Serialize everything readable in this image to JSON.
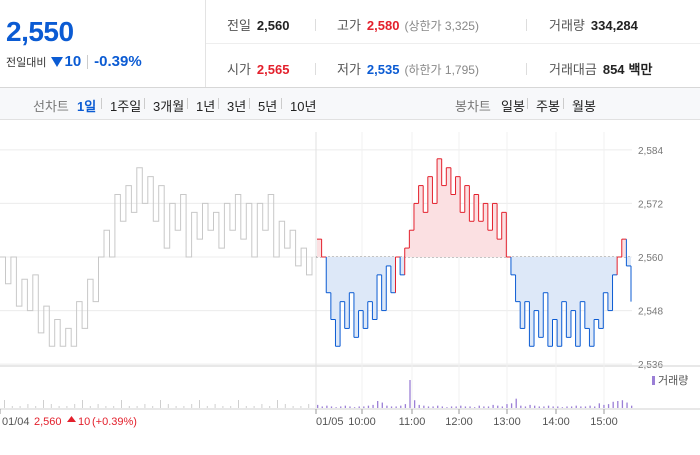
{
  "summary": {
    "price": "2,550",
    "change_label": "전일대비",
    "change_value": "10",
    "change_pct": "-0.39%",
    "prev_close_label": "전일",
    "prev_close": "2,560",
    "high_label": "고가",
    "high": "2,580",
    "upper_limit": "(상한가 3,325)",
    "volume_label": "거래량",
    "volume": "334,284",
    "open_label": "시가",
    "open": "2,565",
    "low_label": "저가",
    "low": "2,535",
    "lower_limit": "(하한가 1,795)",
    "amount_label": "거래대금",
    "amount": "854",
    "amount_unit": "백만"
  },
  "period_bar": {
    "label": "선차트",
    "periods": [
      "1일",
      "1주일",
      "3개월",
      "1년",
      "3년",
      "5년",
      "10년"
    ],
    "active": "1일",
    "candle_label": "봉차트",
    "candles": [
      "일봉",
      "주봉",
      "월봉"
    ]
  },
  "colors": {
    "up": "#e3202c",
    "down": "#0b5bd3",
    "prev_day_line": "#c8c8c8",
    "volume": "#9b7fd6"
  },
  "chart_data": {
    "type": "line",
    "ylim": [
      2532,
      2588
    ],
    "y_ticks": [
      "2,584",
      "2,572",
      "2,560",
      "2,548",
      "2,536"
    ],
    "y_tick_values": [
      2584,
      2572,
      2560,
      2548,
      2536
    ],
    "baseline": 2560,
    "x_labels": [
      "01/04",
      "01/05",
      "10:00",
      "11:00",
      "12:00",
      "13:00",
      "14:00",
      "15:00"
    ],
    "prev_day_label": "01/04",
    "prev_day_close": "2,560",
    "prev_day_change": "10",
    "prev_day_change_pct": "(+0.39%)",
    "volume_legend": "거래량",
    "prev_day_series": [
      2560,
      2554,
      2560,
      2549,
      2555,
      2548,
      2556,
      2543,
      2549,
      2540,
      2546,
      2540,
      2544,
      2540,
      2550,
      2544,
      2555,
      2550,
      2560,
      2566,
      2560,
      2574,
      2568,
      2576,
      2570,
      2580,
      2572,
      2578,
      2568,
      2576,
      2562,
      2572,
      2566,
      2574,
      2560,
      2570,
      2564,
      2572,
      2566,
      2570,
      2562,
      2572,
      2566,
      2574,
      2564,
      2572,
      2560,
      2572,
      2566,
      2574,
      2560,
      2568,
      2562,
      2566,
      2558,
      2562,
      2556,
      2560
    ],
    "today_series": [
      2564,
      2560,
      2552,
      2546,
      2540,
      2550,
      2544,
      2552,
      2542,
      2548,
      2544,
      2550,
      2546,
      2556,
      2548,
      2558,
      2552,
      2560,
      2556,
      2562,
      2566,
      2572,
      2576,
      2570,
      2578,
      2572,
      2582,
      2576,
      2580,
      2574,
      2578,
      2570,
      2576,
      2568,
      2574,
      2568,
      2572,
      2566,
      2572,
      2564,
      2570,
      2560,
      2556,
      2550,
      2544,
      2550,
      2540,
      2548,
      2542,
      2552,
      2540,
      2546,
      2540,
      2550,
      2542,
      2548,
      2540,
      2550,
      2544,
      2540,
      2546,
      2544,
      2552,
      2548,
      2556,
      2560,
      2564,
      2558,
      2550
    ],
    "today_volume": [
      4,
      2,
      3,
      2,
      1,
      2,
      3,
      2,
      1,
      2,
      2,
      3,
      4,
      9,
      7,
      3,
      2,
      2,
      3,
      5,
      36,
      10,
      4,
      3,
      2,
      2,
      3,
      2,
      1,
      2,
      2,
      3,
      2,
      2,
      1,
      3,
      2,
      2,
      4,
      3,
      2,
      5,
      6,
      12,
      3,
      2,
      4,
      3,
      2,
      2,
      3,
      2,
      2,
      1,
      2,
      2,
      3,
      2,
      2,
      3,
      2,
      6,
      4,
      5,
      8,
      9,
      10,
      7,
      3
    ]
  }
}
